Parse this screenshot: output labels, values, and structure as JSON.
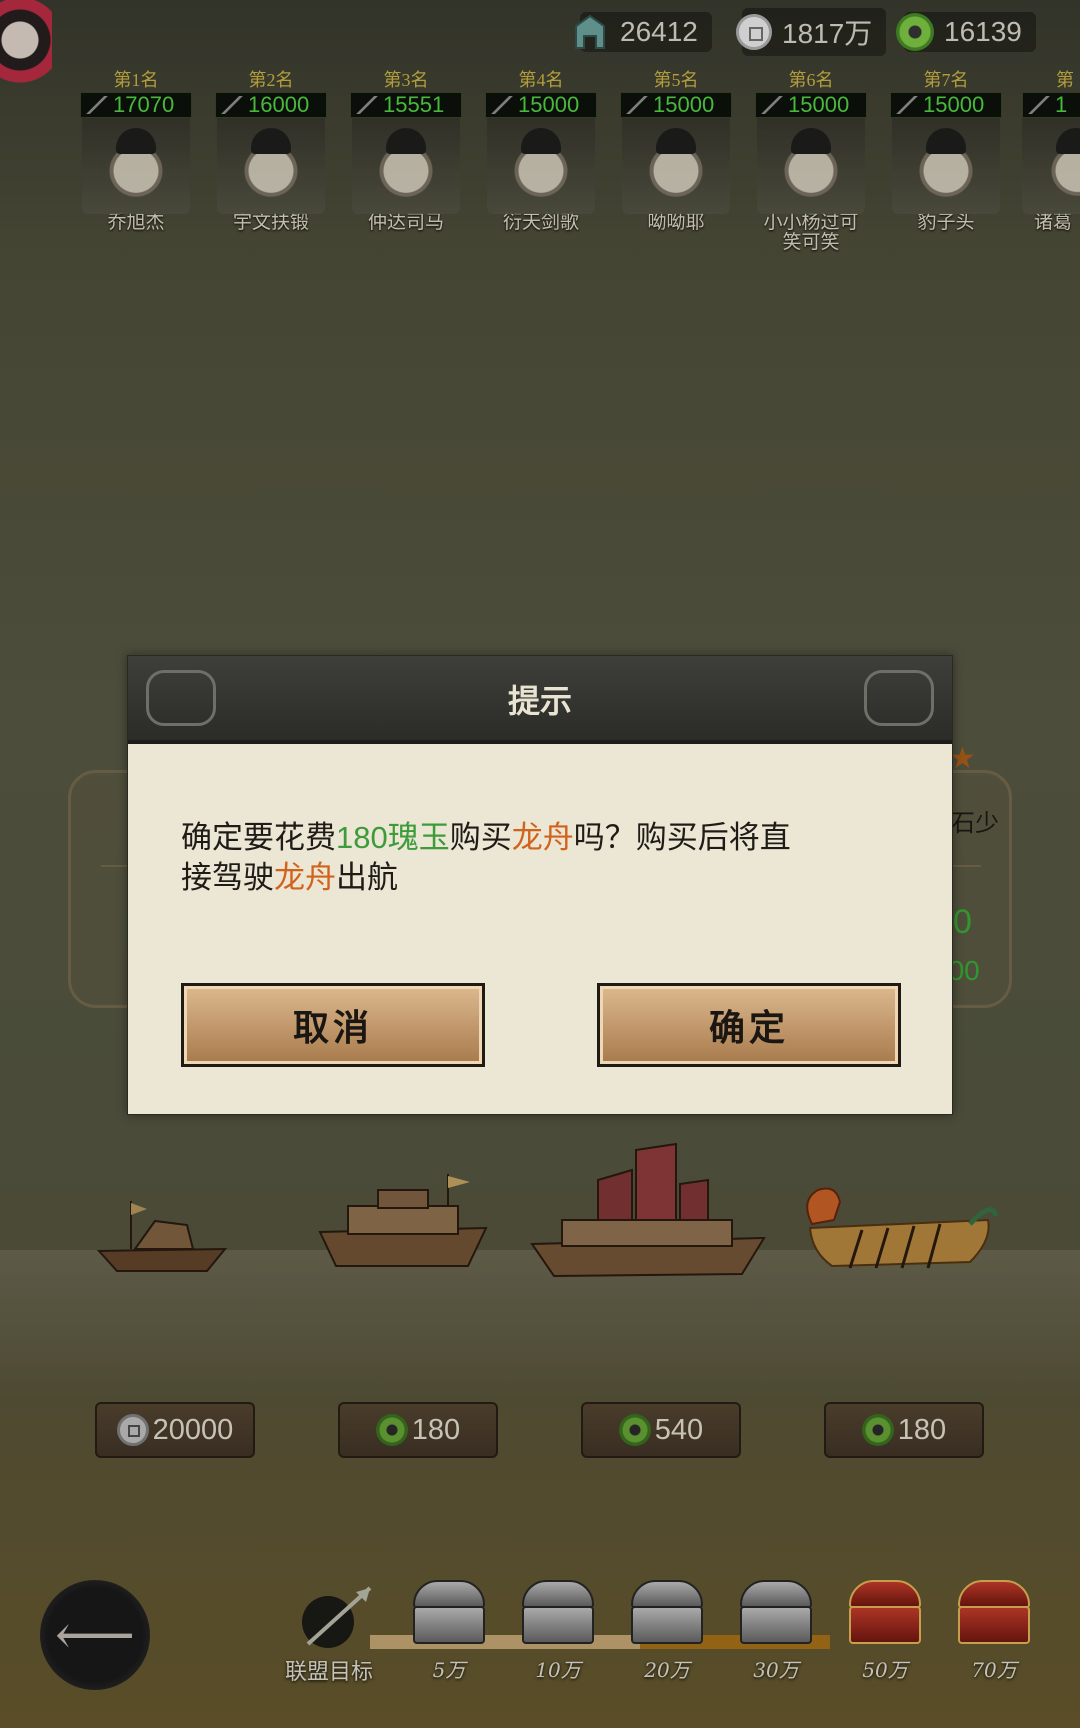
{
  "currency": [
    {
      "icon": "spade-coin-icon",
      "value": "26412"
    },
    {
      "icon": "copper-coin-icon",
      "value": "1817万"
    },
    {
      "icon": "jade-icon",
      "value": "16139"
    }
  ],
  "rankings": [
    {
      "place": "第1名",
      "score": "17070",
      "name": "乔旭杰"
    },
    {
      "place": "第2名",
      "score": "16000",
      "name": "宇文扶锻"
    },
    {
      "place": "第3名",
      "score": "15551",
      "name": "仲达司马"
    },
    {
      "place": "第4名",
      "score": "15000",
      "name": "衍天剑歌"
    },
    {
      "place": "第5名",
      "score": "15000",
      "name": "呦呦耶"
    },
    {
      "place": "第6名",
      "score": "15000",
      "name": "小小杨过可",
      "name2": "笑可笑"
    },
    {
      "place": "第7名",
      "score": "15000",
      "name": "豹子头"
    },
    {
      "place": "第",
      "score": "1",
      "name": "诸葛"
    }
  ],
  "background_fragments": {
    "right_text": "石少",
    "right_num1": "0",
    "right_num2": "500"
  },
  "dialog": {
    "title": "提示",
    "msg_part1": "确定要花费",
    "msg_amount": "180瑰玉",
    "msg_part2": "购买",
    "msg_item": "龙舟",
    "msg_part3": "吗？购买后将直",
    "msg_part4": "接驾驶",
    "msg_item2": "龙舟",
    "msg_part5": "出航",
    "cancel_label": "取消",
    "confirm_label": "确定"
  },
  "ships": [
    {
      "name": "small-boat",
      "price": "20000",
      "currency": "copper-coin-icon"
    },
    {
      "name": "war-junk",
      "price": "180",
      "currency": "jade-icon"
    },
    {
      "name": "treasure-ship",
      "price": "540",
      "currency": "jade-icon"
    },
    {
      "name": "dragon-boat",
      "price": "180",
      "currency": "jade-icon"
    }
  ],
  "alliance_goal": {
    "label": "联盟目标",
    "milestones": [
      "5万",
      "10万",
      "20万",
      "30万",
      "50万",
      "70万"
    ]
  },
  "colors": {
    "accent_green": "#3d9b3a",
    "accent_orange": "#d2631d",
    "button": "#c49a6c"
  }
}
